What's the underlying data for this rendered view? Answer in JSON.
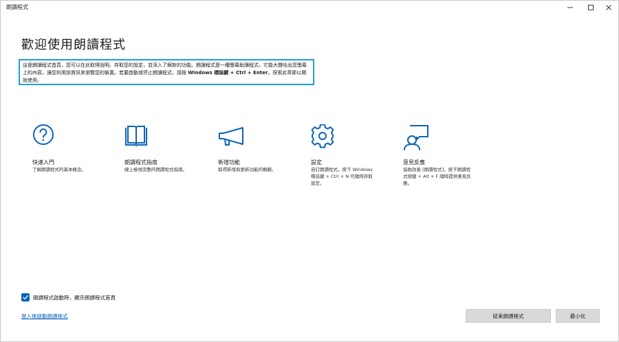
{
  "window": {
    "title": "朗讀程式"
  },
  "main": {
    "heading": "歡迎使用朗讀程式",
    "intro": {
      "part1": "這是朗讀程式首頁，您可以在此取得說明、存取您的設定，並深入了解新的功能。朗讀程式是一種螢幕助讀程式，它能大聲唸出您螢幕上的內容，讓您利用該資訊來瀏覽您的裝置。若要啟動或停止朗讀程式，請按 ",
      "key": "Windows 標誌鍵 + Ctrl + Enter",
      "part2": "。探索此章節以開始使用。"
    },
    "features": [
      {
        "name": "快速入門",
        "desc": "了解朗讀程式的基本概念。",
        "icon": "question-circle-icon"
      },
      {
        "name": "朗讀程式指南",
        "desc": "線上檢視完整的朗讀程式指南。",
        "icon": "open-book-icon"
      },
      {
        "name": "新增功能",
        "desc": "取得新增與更新功能的概觀。",
        "icon": "megaphone-icon"
      },
      {
        "name": "設定",
        "desc": "自訂朗讀程式，按下 Windows 標誌鍵 + Ctrl + N 可隨時存取設定。",
        "icon": "gear-icon"
      },
      {
        "name": "意見反應",
        "desc": "協助改善 [朗讀程式]，按下朗讀程式按鍵 + Alt + F 隨時提供意見反應。",
        "icon": "feedback-person-icon"
      }
    ]
  },
  "footer": {
    "checkbox_label": "朗讀程式啟動時，顯示朗讀程式首頁",
    "checkbox_checked": true,
    "link": "登入後啟動朗讀程式",
    "exit_button": "結束朗讀程式",
    "minimize_button": "最小化"
  },
  "colors": {
    "accent": "#0a63b8",
    "highlight_border": "#1ea0d7",
    "button_bg": "#d9d9d9"
  }
}
